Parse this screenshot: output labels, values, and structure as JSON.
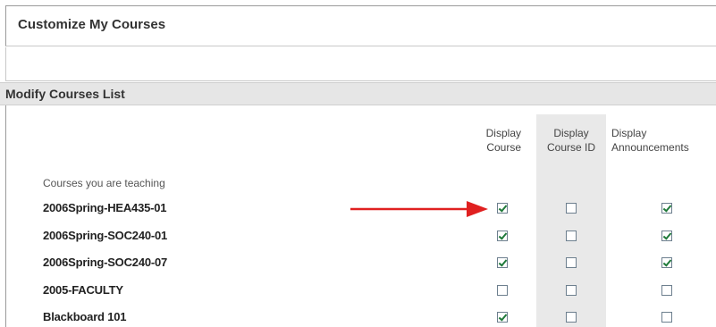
{
  "page": {
    "title": "Customize My Courses",
    "section_header": "Modify Courses List"
  },
  "columns": {
    "display_course": [
      "Display",
      "Course"
    ],
    "display_course_id": [
      "Display",
      "Course ID"
    ],
    "display_announcements": [
      "Display",
      "Announcements"
    ]
  },
  "courses_caption": "Courses you are teaching",
  "courses": [
    {
      "name": "2006Spring-HEA435-01",
      "display_course": true,
      "display_course_id": false,
      "display_announcements": true
    },
    {
      "name": "2006Spring-SOC240-01",
      "display_course": true,
      "display_course_id": false,
      "display_announcements": true
    },
    {
      "name": "2006Spring-SOC240-07",
      "display_course": true,
      "display_course_id": false,
      "display_announcements": true
    },
    {
      "name": "2005-FACULTY",
      "display_course": false,
      "display_course_id": false,
      "display_announcements": false
    },
    {
      "name": "Blackboard 101",
      "display_course": true,
      "display_course_id": false,
      "display_announcements": false
    }
  ],
  "colors": {
    "arrow": "#e02020",
    "checkmark": "#1f7a3a",
    "section_bg": "#e6e6e6",
    "course_id_column_bg": "#e9e9e9"
  },
  "annotation": {
    "icon": "red-arrow-icon",
    "points_to_row": 0
  }
}
